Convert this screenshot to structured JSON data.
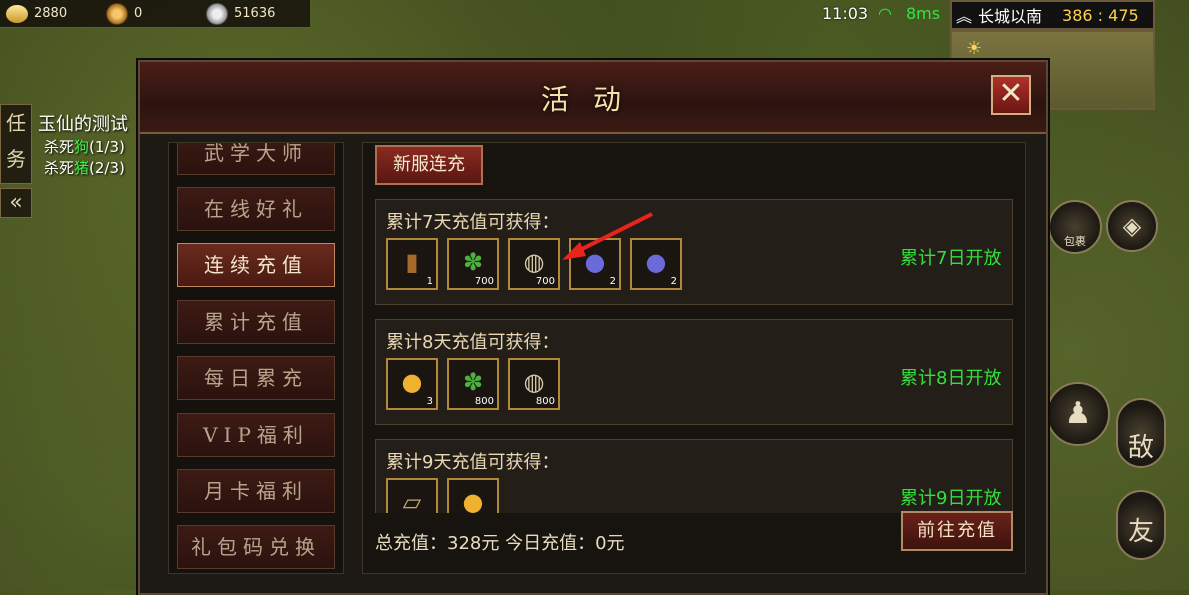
{
  "resources": [
    {
      "icon": "gold-ingot-icon",
      "value": "2880"
    },
    {
      "icon": "copper-coin-icon",
      "value": "0"
    },
    {
      "icon": "silver-coin-icon",
      "value": "51636"
    }
  ],
  "status": {
    "time": "11:03",
    "ping": "8ms"
  },
  "map": {
    "name": "长城以南",
    "coords": "386 : 475"
  },
  "quest": {
    "tab_label": "任务",
    "title": "玉仙的测试",
    "line1_prefix": "杀死",
    "line1_target": "狗",
    "line1_progress": "(1/3)",
    "line2_prefix": "杀死",
    "line2_target": "猪",
    "line2_progress": "(2/3)"
  },
  "side_buttons": {
    "bag": "包裹",
    "enemy": "敌",
    "friend": "友"
  },
  "dialog": {
    "title": "活动",
    "sidebar": [
      "武学大师",
      "在线好礼",
      "连续充值",
      "累计充值",
      "每日累充",
      "VIP福利",
      "月卡福利",
      "礼包码兑换"
    ],
    "active_index": 2,
    "tab": "新服连充",
    "rewards": [
      {
        "title": "累计7天充值可获得：",
        "status": "累计7日开放",
        "items": [
          {
            "icon": "book-icon",
            "count": "1"
          },
          {
            "icon": "herb-icon",
            "count": "700"
          },
          {
            "icon": "drum-icon",
            "count": "700"
          },
          {
            "icon": "pouch-icon",
            "count": "2"
          },
          {
            "icon": "pouch-icon",
            "count": "2"
          }
        ]
      },
      {
        "title": "累计8天充值可获得：",
        "status": "累计8日开放",
        "items": [
          {
            "icon": "gold-orb-icon",
            "count": "3"
          },
          {
            "icon": "herb-icon",
            "count": "800"
          },
          {
            "icon": "drum-icon",
            "count": "800"
          }
        ]
      },
      {
        "title": "累计9天充值可获得：",
        "status": "累计9日开放",
        "items": [
          {
            "icon": "scroll-icon",
            "count": ""
          },
          {
            "icon": "gold-orb-icon",
            "count": ""
          }
        ]
      }
    ],
    "totals": "总充值：328元  今日充值：0元",
    "recharge_button": "前往充值"
  }
}
